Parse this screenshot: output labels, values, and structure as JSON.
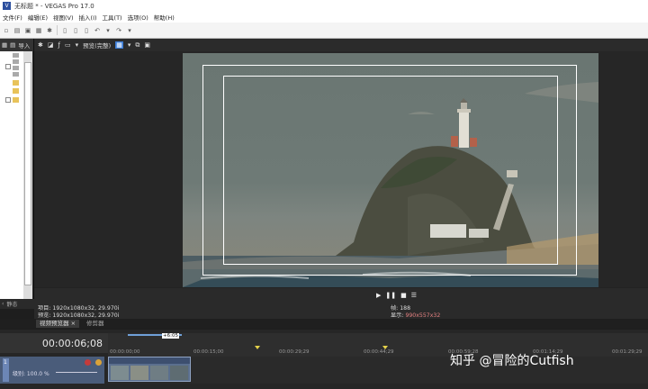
{
  "window": {
    "app_icon": "V",
    "title": "无标题 * - VEGAS Pro 17.0"
  },
  "menu": [
    "文件(F)",
    "编辑(E)",
    "视图(V)",
    "插入(I)",
    "工具(T)",
    "选项(O)",
    "帮助(H)"
  ],
  "explorer": {
    "import_label": "导入",
    "footer_label": "静态"
  },
  "preview_toolbar": {
    "quality": "预览(完整)"
  },
  "preview_info": {
    "project": "项目: 1920x1080x32, 29.970i",
    "preview": "预览: 1920x1080x32, 29.970i",
    "frame": "帧:     188",
    "display_label": "显示: ",
    "display_value": "990x557x32"
  },
  "panel_tabs": [
    "视频预览器",
    "修剪器"
  ],
  "timeline": {
    "timecode": "00:00:06;08",
    "loop_tag": "+6:05",
    "ruler": [
      "00:00:00;00",
      "00:00:15;00",
      "00:00:29;29",
      "00:00:44;29",
      "00:00:59;28",
      "00:01:14;29",
      "00:01:29;29"
    ],
    "track_label": "级别: 100.0 %",
    "track_number": "1"
  },
  "watermark": "知乎 @冒险的Cutfish",
  "colors": {
    "accent": "#3a7bd5",
    "display_value": "#e38080",
    "marker": "#e5d24a"
  }
}
